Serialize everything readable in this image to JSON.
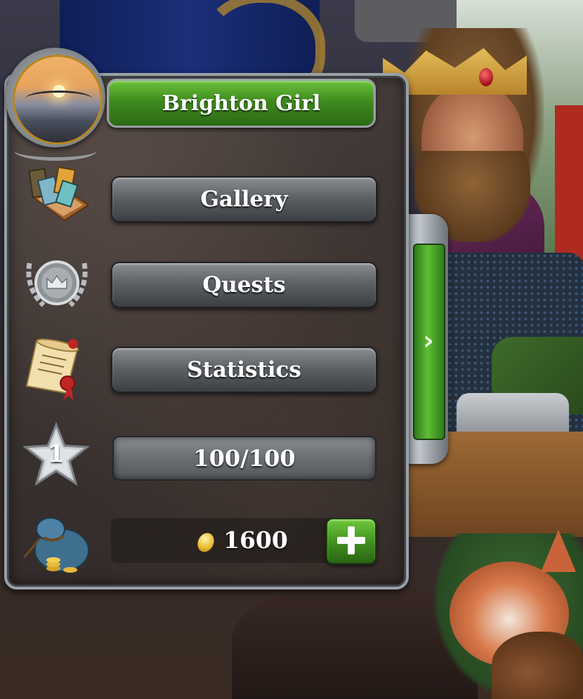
{
  "profile": {
    "player_name": "Brighton Girl",
    "avatar_icon": "sunset-bridge-avatar"
  },
  "menu": {
    "items": [
      {
        "label": "Gallery",
        "icon": "cards-icon"
      },
      {
        "label": "Quests",
        "icon": "crown-medal-icon"
      },
      {
        "label": "Statistics",
        "icon": "scroll-icon"
      }
    ]
  },
  "level": {
    "value": "1",
    "experience": "100/100",
    "icon": "star-icon"
  },
  "gold": {
    "amount": "1600",
    "icon": "coin-bag-icon",
    "add_icon": "plus-icon"
  },
  "side_tab": {
    "icon": "chevron-right-icon",
    "glyph": "›"
  },
  "colors": {
    "green_button": "#3f8b1f",
    "grey_button": "#5e6266",
    "panel_border": "#9aa0a6"
  }
}
